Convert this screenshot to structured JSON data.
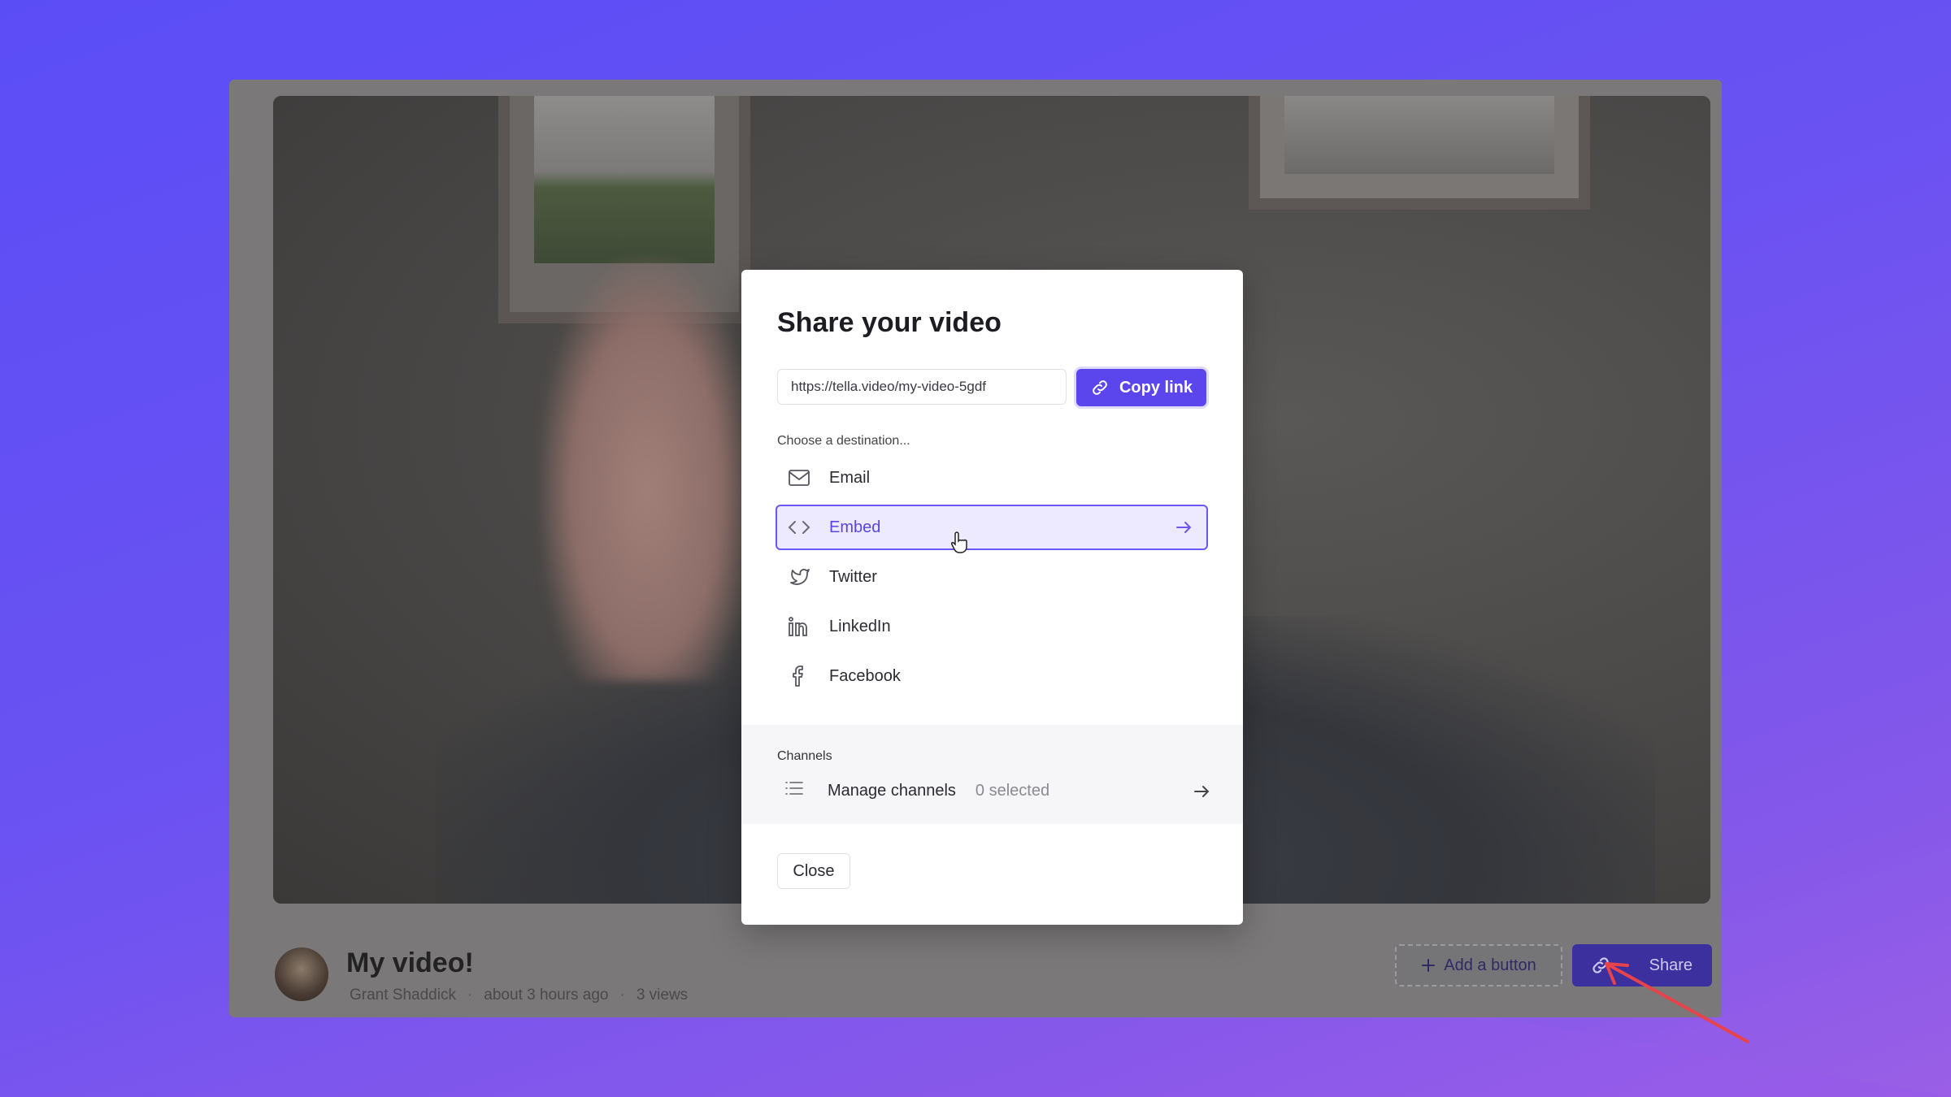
{
  "video": {
    "title": "My video!",
    "author": "Grant Shaddick",
    "time": "about 3 hours ago",
    "views": "3 views",
    "meta_separator": "·"
  },
  "actions": {
    "add_button_label": "Add a button",
    "share_label": "Share"
  },
  "modal": {
    "title": "Share your video",
    "url": "https://tella.video/my-video-5gdf",
    "copy_label": "Copy link",
    "destination_label": "Choose a destination...",
    "destinations": [
      {
        "label": "Email",
        "icon": "mail-icon"
      },
      {
        "label": "Embed",
        "icon": "code-icon",
        "active": true
      },
      {
        "label": "Twitter",
        "icon": "twitter-icon"
      },
      {
        "label": "LinkedIn",
        "icon": "linkedin-icon"
      },
      {
        "label": "Facebook",
        "icon": "facebook-icon"
      }
    ],
    "channels_label": "Channels",
    "manage_channels_label": "Manage channels",
    "channels_count": "0 selected",
    "close_label": "Close"
  },
  "colors": {
    "accent": "#5b46ee",
    "background": "#5b4df6"
  }
}
